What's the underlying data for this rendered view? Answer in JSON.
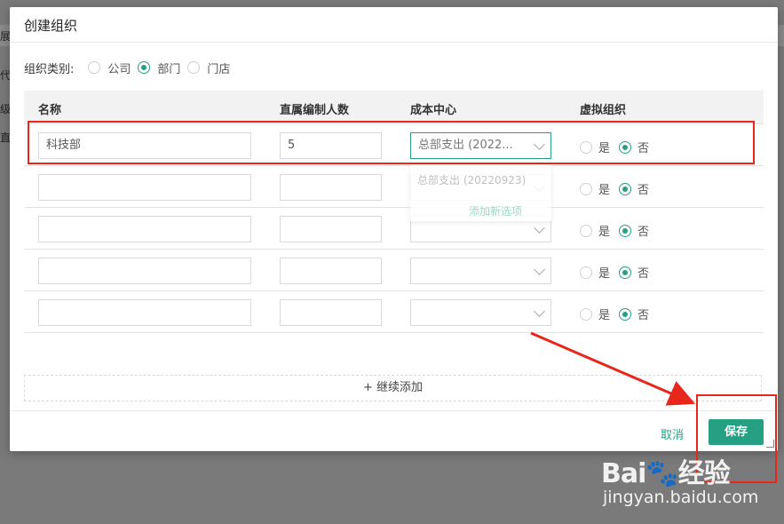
{
  "background": {
    "peek_chars": [
      "展",
      "代",
      "级",
      "直"
    ]
  },
  "modal": {
    "title": "创建组织",
    "type_label": "组织类别:",
    "type_options": [
      {
        "label": "公司",
        "selected": false
      },
      {
        "label": "部门",
        "selected": true
      },
      {
        "label": "门店",
        "selected": false
      }
    ],
    "columns": [
      "名称",
      "直属编制人数",
      "成本中心",
      "虚拟组织"
    ],
    "rows": [
      {
        "name": "科技部",
        "headcount": "5",
        "cost_center": "总部支出 (2022...",
        "virtual_yes": "是",
        "virtual_no": "否",
        "virtual": "no"
      },
      {
        "name": "",
        "headcount": "",
        "cost_center": "",
        "virtual_yes": "是",
        "virtual_no": "否",
        "virtual": "no"
      },
      {
        "name": "",
        "headcount": "",
        "cost_center": "",
        "virtual_yes": "是",
        "virtual_no": "否",
        "virtual": "no"
      },
      {
        "name": "",
        "headcount": "",
        "cost_center": "",
        "virtual_yes": "是",
        "virtual_no": "否",
        "virtual": "no"
      },
      {
        "name": "",
        "headcount": "",
        "cost_center": "",
        "virtual_yes": "是",
        "virtual_no": "否",
        "virtual": "no"
      }
    ],
    "dropdown": {
      "option": "总部支出 (20220923)",
      "add_new": "添加新选项"
    },
    "add_more": "+ 继续添加",
    "cancel": "取消",
    "save": "保存"
  },
  "watermark": {
    "logo": "Bai🐾经验",
    "url": "jingyan.baidu.com"
  },
  "colors": {
    "accent": "#26a083",
    "annotation": "#e8261c"
  }
}
